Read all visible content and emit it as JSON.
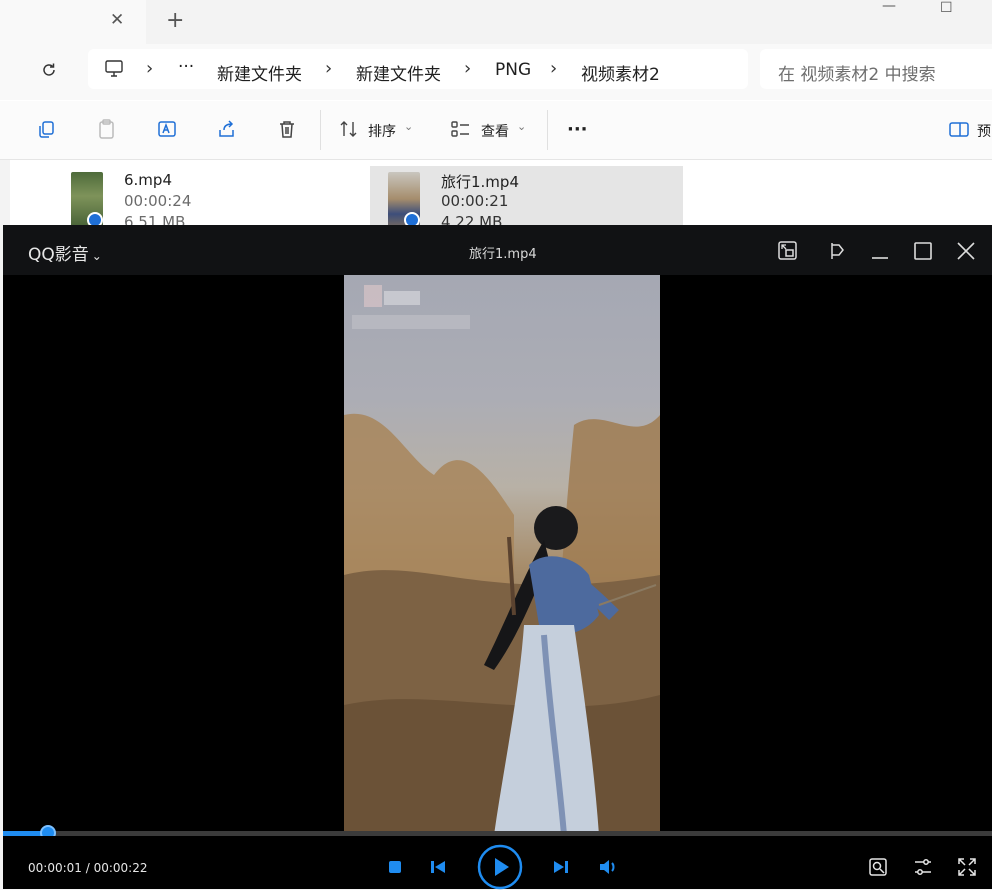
{
  "explorer": {
    "tab": {
      "close_glyph": "✕",
      "new_glyph": "+"
    },
    "window_controls": {
      "minimize": "—",
      "maximize": "☐"
    },
    "breadcrumb": [
      "新建文件夹",
      "新建文件夹",
      "PNG",
      "视频素材2"
    ],
    "breadcrumb_overflow": "···",
    "search_placeholder": "在 视频素材2 中搜索",
    "toolbar": {
      "sort_label": "排序",
      "view_label": "查看",
      "more_label": "···",
      "preview_label": "预"
    },
    "files": [
      {
        "name": "6.mp4",
        "duration": "00:00:24",
        "size": "6.51 MB",
        "selected": false
      },
      {
        "name": "旅行1.mp4",
        "duration": "00:00:21",
        "size": "4.22 MB",
        "selected": true
      }
    ]
  },
  "player": {
    "brand": "QQ影音",
    "file_title": "旅行1.mp4",
    "time_display": "00:00:01 / 00:00:22",
    "progress_fraction": 0.045,
    "accent": "#1f8cf0"
  }
}
